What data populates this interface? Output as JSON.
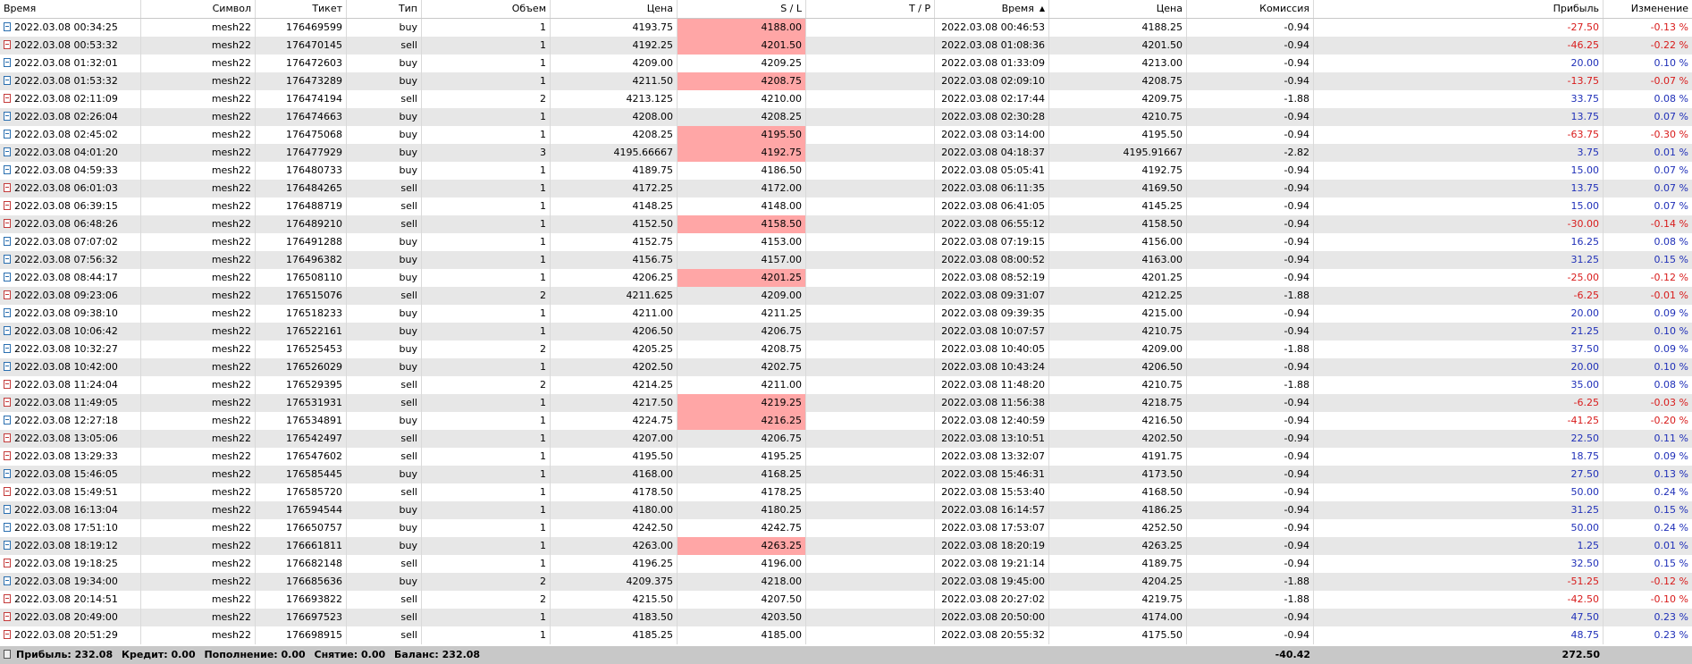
{
  "headers": {
    "time": "Время",
    "symbol": "Символ",
    "ticket": "Тикет",
    "type": "Тип",
    "volume": "Объем",
    "price": "Цена",
    "sl": "S / L",
    "tp": "T / P",
    "close_time": "Время",
    "close_price": "Цена",
    "commission": "Комиссия",
    "profit": "Прибыль",
    "change": "Изменение"
  },
  "colors": {
    "sl_hit_background": "#ffa6a6",
    "negative": "#d81b1b",
    "positive": "#1f2fb8",
    "alt_row": "#e7e7e7",
    "footer_background": "#c8c8c8"
  },
  "rows": [
    {
      "time": "2022.03.08 00:34:25",
      "symbol": "mesh22",
      "ticket": "176469599",
      "type": "buy",
      "volume": "1",
      "price": "4193.75",
      "sl": "4188.00",
      "sl_hit": true,
      "tp": "",
      "close_time": "2022.03.08 00:46:53",
      "close_price": "4188.25",
      "commission": "-0.94",
      "profit": "-27.50",
      "change": "-0.13 %",
      "negative": true
    },
    {
      "time": "2022.03.08 00:53:32",
      "symbol": "mesh22",
      "ticket": "176470145",
      "type": "sell",
      "volume": "1",
      "price": "4192.25",
      "sl": "4201.50",
      "sl_hit": true,
      "tp": "",
      "close_time": "2022.03.08 01:08:36",
      "close_price": "4201.50",
      "commission": "-0.94",
      "profit": "-46.25",
      "change": "-0.22 %",
      "negative": true
    },
    {
      "time": "2022.03.08 01:32:01",
      "symbol": "mesh22",
      "ticket": "176472603",
      "type": "buy",
      "volume": "1",
      "price": "4209.00",
      "sl": "4209.25",
      "sl_hit": false,
      "tp": "",
      "close_time": "2022.03.08 01:33:09",
      "close_price": "4213.00",
      "commission": "-0.94",
      "profit": "20.00",
      "change": "0.10 %",
      "negative": false
    },
    {
      "time": "2022.03.08 01:53:32",
      "symbol": "mesh22",
      "ticket": "176473289",
      "type": "buy",
      "volume": "1",
      "price": "4211.50",
      "sl": "4208.75",
      "sl_hit": true,
      "tp": "",
      "close_time": "2022.03.08 02:09:10",
      "close_price": "4208.75",
      "commission": "-0.94",
      "profit": "-13.75",
      "change": "-0.07 %",
      "negative": true
    },
    {
      "time": "2022.03.08 02:11:09",
      "symbol": "mesh22",
      "ticket": "176474194",
      "type": "sell",
      "volume": "2",
      "price": "4213.125",
      "sl": "4210.00",
      "sl_hit": false,
      "tp": "",
      "close_time": "2022.03.08 02:17:44",
      "close_price": "4209.75",
      "commission": "-1.88",
      "profit": "33.75",
      "change": "0.08 %",
      "negative": false
    },
    {
      "time": "2022.03.08 02:26:04",
      "symbol": "mesh22",
      "ticket": "176474663",
      "type": "buy",
      "volume": "1",
      "price": "4208.00",
      "sl": "4208.25",
      "sl_hit": false,
      "tp": "",
      "close_time": "2022.03.08 02:30:28",
      "close_price": "4210.75",
      "commission": "-0.94",
      "profit": "13.75",
      "change": "0.07 %",
      "negative": false
    },
    {
      "time": "2022.03.08 02:45:02",
      "symbol": "mesh22",
      "ticket": "176475068",
      "type": "buy",
      "volume": "1",
      "price": "4208.25",
      "sl": "4195.50",
      "sl_hit": true,
      "tp": "",
      "close_time": "2022.03.08 03:14:00",
      "close_price": "4195.50",
      "commission": "-0.94",
      "profit": "-63.75",
      "change": "-0.30 %",
      "negative": true
    },
    {
      "time": "2022.03.08 04:01:20",
      "symbol": "mesh22",
      "ticket": "176477929",
      "type": "buy",
      "volume": "3",
      "price": "4195.66667",
      "sl": "4192.75",
      "sl_hit": true,
      "tp": "",
      "close_time": "2022.03.08 04:18:37",
      "close_price": "4195.91667",
      "commission": "-2.82",
      "profit": "3.75",
      "change": "0.01 %",
      "negative": false
    },
    {
      "time": "2022.03.08 04:59:33",
      "symbol": "mesh22",
      "ticket": "176480733",
      "type": "buy",
      "volume": "1",
      "price": "4189.75",
      "sl": "4186.50",
      "sl_hit": false,
      "tp": "",
      "close_time": "2022.03.08 05:05:41",
      "close_price": "4192.75",
      "commission": "-0.94",
      "profit": "15.00",
      "change": "0.07 %",
      "negative": false
    },
    {
      "time": "2022.03.08 06:01:03",
      "symbol": "mesh22",
      "ticket": "176484265",
      "type": "sell",
      "volume": "1",
      "price": "4172.25",
      "sl": "4172.00",
      "sl_hit": false,
      "tp": "",
      "close_time": "2022.03.08 06:11:35",
      "close_price": "4169.50",
      "commission": "-0.94",
      "profit": "13.75",
      "change": "0.07 %",
      "negative": false
    },
    {
      "time": "2022.03.08 06:39:15",
      "symbol": "mesh22",
      "ticket": "176488719",
      "type": "sell",
      "volume": "1",
      "price": "4148.25",
      "sl": "4148.00",
      "sl_hit": false,
      "tp": "",
      "close_time": "2022.03.08 06:41:05",
      "close_price": "4145.25",
      "commission": "-0.94",
      "profit": "15.00",
      "change": "0.07 %",
      "negative": false
    },
    {
      "time": "2022.03.08 06:48:26",
      "symbol": "mesh22",
      "ticket": "176489210",
      "type": "sell",
      "volume": "1",
      "price": "4152.50",
      "sl": "4158.50",
      "sl_hit": true,
      "tp": "",
      "close_time": "2022.03.08 06:55:12",
      "close_price": "4158.50",
      "commission": "-0.94",
      "profit": "-30.00",
      "change": "-0.14 %",
      "negative": true
    },
    {
      "time": "2022.03.08 07:07:02",
      "symbol": "mesh22",
      "ticket": "176491288",
      "type": "buy",
      "volume": "1",
      "price": "4152.75",
      "sl": "4153.00",
      "sl_hit": false,
      "tp": "",
      "close_time": "2022.03.08 07:19:15",
      "close_price": "4156.00",
      "commission": "-0.94",
      "profit": "16.25",
      "change": "0.08 %",
      "negative": false
    },
    {
      "time": "2022.03.08 07:56:32",
      "symbol": "mesh22",
      "ticket": "176496382",
      "type": "buy",
      "volume": "1",
      "price": "4156.75",
      "sl": "4157.00",
      "sl_hit": false,
      "tp": "",
      "close_time": "2022.03.08 08:00:52",
      "close_price": "4163.00",
      "commission": "-0.94",
      "profit": "31.25",
      "change": "0.15 %",
      "negative": false
    },
    {
      "time": "2022.03.08 08:44:17",
      "symbol": "mesh22",
      "ticket": "176508110",
      "type": "buy",
      "volume": "1",
      "price": "4206.25",
      "sl": "4201.25",
      "sl_hit": true,
      "tp": "",
      "close_time": "2022.03.08 08:52:19",
      "close_price": "4201.25",
      "commission": "-0.94",
      "profit": "-25.00",
      "change": "-0.12 %",
      "negative": true
    },
    {
      "time": "2022.03.08 09:23:06",
      "symbol": "mesh22",
      "ticket": "176515076",
      "type": "sell",
      "volume": "2",
      "price": "4211.625",
      "sl": "4209.00",
      "sl_hit": false,
      "tp": "",
      "close_time": "2022.03.08 09:31:07",
      "close_price": "4212.25",
      "commission": "-1.88",
      "profit": "-6.25",
      "change": "-0.01 %",
      "negative": true
    },
    {
      "time": "2022.03.08 09:38:10",
      "symbol": "mesh22",
      "ticket": "176518233",
      "type": "buy",
      "volume": "1",
      "price": "4211.00",
      "sl": "4211.25",
      "sl_hit": false,
      "tp": "",
      "close_time": "2022.03.08 09:39:35",
      "close_price": "4215.00",
      "commission": "-0.94",
      "profit": "20.00",
      "change": "0.09 %",
      "negative": false
    },
    {
      "time": "2022.03.08 10:06:42",
      "symbol": "mesh22",
      "ticket": "176522161",
      "type": "buy",
      "volume": "1",
      "price": "4206.50",
      "sl": "4206.75",
      "sl_hit": false,
      "tp": "",
      "close_time": "2022.03.08 10:07:57",
      "close_price": "4210.75",
      "commission": "-0.94",
      "profit": "21.25",
      "change": "0.10 %",
      "negative": false
    },
    {
      "time": "2022.03.08 10:32:27",
      "symbol": "mesh22",
      "ticket": "176525453",
      "type": "buy",
      "volume": "2",
      "price": "4205.25",
      "sl": "4208.75",
      "sl_hit": false,
      "tp": "",
      "close_time": "2022.03.08 10:40:05",
      "close_price": "4209.00",
      "commission": "-1.88",
      "profit": "37.50",
      "change": "0.09 %",
      "negative": false
    },
    {
      "time": "2022.03.08 10:42:00",
      "symbol": "mesh22",
      "ticket": "176526029",
      "type": "buy",
      "volume": "1",
      "price": "4202.50",
      "sl": "4202.75",
      "sl_hit": false,
      "tp": "",
      "close_time": "2022.03.08 10:43:24",
      "close_price": "4206.50",
      "commission": "-0.94",
      "profit": "20.00",
      "change": "0.10 %",
      "negative": false
    },
    {
      "time": "2022.03.08 11:24:04",
      "symbol": "mesh22",
      "ticket": "176529395",
      "type": "sell",
      "volume": "2",
      "price": "4214.25",
      "sl": "4211.00",
      "sl_hit": false,
      "tp": "",
      "close_time": "2022.03.08 11:48:20",
      "close_price": "4210.75",
      "commission": "-1.88",
      "profit": "35.00",
      "change": "0.08 %",
      "negative": false
    },
    {
      "time": "2022.03.08 11:49:05",
      "symbol": "mesh22",
      "ticket": "176531931",
      "type": "sell",
      "volume": "1",
      "price": "4217.50",
      "sl": "4219.25",
      "sl_hit": true,
      "tp": "",
      "close_time": "2022.03.08 11:56:38",
      "close_price": "4218.75",
      "commission": "-0.94",
      "profit": "-6.25",
      "change": "-0.03 %",
      "negative": true
    },
    {
      "time": "2022.03.08 12:27:18",
      "symbol": "mesh22",
      "ticket": "176534891",
      "type": "buy",
      "volume": "1",
      "price": "4224.75",
      "sl": "4216.25",
      "sl_hit": true,
      "tp": "",
      "close_time": "2022.03.08 12:40:59",
      "close_price": "4216.50",
      "commission": "-0.94",
      "profit": "-41.25",
      "change": "-0.20 %",
      "negative": true
    },
    {
      "time": "2022.03.08 13:05:06",
      "symbol": "mesh22",
      "ticket": "176542497",
      "type": "sell",
      "volume": "1",
      "price": "4207.00",
      "sl": "4206.75",
      "sl_hit": false,
      "tp": "",
      "close_time": "2022.03.08 13:10:51",
      "close_price": "4202.50",
      "commission": "-0.94",
      "profit": "22.50",
      "change": "0.11 %",
      "negative": false
    },
    {
      "time": "2022.03.08 13:29:33",
      "symbol": "mesh22",
      "ticket": "176547602",
      "type": "sell",
      "volume": "1",
      "price": "4195.50",
      "sl": "4195.25",
      "sl_hit": false,
      "tp": "",
      "close_time": "2022.03.08 13:32:07",
      "close_price": "4191.75",
      "commission": "-0.94",
      "profit": "18.75",
      "change": "0.09 %",
      "negative": false
    },
    {
      "time": "2022.03.08 15:46:05",
      "symbol": "mesh22",
      "ticket": "176585445",
      "type": "buy",
      "volume": "1",
      "price": "4168.00",
      "sl": "4168.25",
      "sl_hit": false,
      "tp": "",
      "close_time": "2022.03.08 15:46:31",
      "close_price": "4173.50",
      "commission": "-0.94",
      "profit": "27.50",
      "change": "0.13 %",
      "negative": false
    },
    {
      "time": "2022.03.08 15:49:51",
      "symbol": "mesh22",
      "ticket": "176585720",
      "type": "sell",
      "volume": "1",
      "price": "4178.50",
      "sl": "4178.25",
      "sl_hit": false,
      "tp": "",
      "close_time": "2022.03.08 15:53:40",
      "close_price": "4168.50",
      "commission": "-0.94",
      "profit": "50.00",
      "change": "0.24 %",
      "negative": false
    },
    {
      "time": "2022.03.08 16:13:04",
      "symbol": "mesh22",
      "ticket": "176594544",
      "type": "buy",
      "volume": "1",
      "price": "4180.00",
      "sl": "4180.25",
      "sl_hit": false,
      "tp": "",
      "close_time": "2022.03.08 16:14:57",
      "close_price": "4186.25",
      "commission": "-0.94",
      "profit": "31.25",
      "change": "0.15 %",
      "negative": false
    },
    {
      "time": "2022.03.08 17:51:10",
      "symbol": "mesh22",
      "ticket": "176650757",
      "type": "buy",
      "volume": "1",
      "price": "4242.50",
      "sl": "4242.75",
      "sl_hit": false,
      "tp": "",
      "close_time": "2022.03.08 17:53:07",
      "close_price": "4252.50",
      "commission": "-0.94",
      "profit": "50.00",
      "change": "0.24 %",
      "negative": false
    },
    {
      "time": "2022.03.08 18:19:12",
      "symbol": "mesh22",
      "ticket": "176661811",
      "type": "buy",
      "volume": "1",
      "price": "4263.00",
      "sl": "4263.25",
      "sl_hit": true,
      "tp": "",
      "close_time": "2022.03.08 18:20:19",
      "close_price": "4263.25",
      "commission": "-0.94",
      "profit": "1.25",
      "change": "0.01 %",
      "negative": false
    },
    {
      "time": "2022.03.08 19:18:25",
      "symbol": "mesh22",
      "ticket": "176682148",
      "type": "sell",
      "volume": "1",
      "price": "4196.25",
      "sl": "4196.00",
      "sl_hit": false,
      "tp": "",
      "close_time": "2022.03.08 19:21:14",
      "close_price": "4189.75",
      "commission": "-0.94",
      "profit": "32.50",
      "change": "0.15 %",
      "negative": false
    },
    {
      "time": "2022.03.08 19:34:00",
      "symbol": "mesh22",
      "ticket": "176685636",
      "type": "buy",
      "volume": "2",
      "price": "4209.375",
      "sl": "4218.00",
      "sl_hit": false,
      "tp": "",
      "close_time": "2022.03.08 19:45:00",
      "close_price": "4204.25",
      "commission": "-1.88",
      "profit": "-51.25",
      "change": "-0.12 %",
      "negative": true
    },
    {
      "time": "2022.03.08 20:14:51",
      "symbol": "mesh22",
      "ticket": "176693822",
      "type": "sell",
      "volume": "2",
      "price": "4215.50",
      "sl": "4207.50",
      "sl_hit": false,
      "tp": "",
      "close_time": "2022.03.08 20:27:02",
      "close_price": "4219.75",
      "commission": "-1.88",
      "profit": "-42.50",
      "change": "-0.10 %",
      "negative": true
    },
    {
      "time": "2022.03.08 20:49:00",
      "symbol": "mesh22",
      "ticket": "176697523",
      "type": "sell",
      "volume": "1",
      "price": "4183.50",
      "sl": "4203.50",
      "sl_hit": false,
      "tp": "",
      "close_time": "2022.03.08 20:50:00",
      "close_price": "4174.00",
      "commission": "-0.94",
      "profit": "47.50",
      "change": "0.23 %",
      "negative": false
    },
    {
      "time": "2022.03.08 20:51:29",
      "symbol": "mesh22",
      "ticket": "176698915",
      "type": "sell",
      "volume": "1",
      "price": "4185.25",
      "sl": "4185.00",
      "sl_hit": false,
      "tp": "",
      "close_time": "2022.03.08 20:55:32",
      "close_price": "4175.50",
      "commission": "-0.94",
      "profit": "48.75",
      "change": "0.23 %",
      "negative": false
    }
  ],
  "footer": {
    "profit_label": "Прибыль: 232.08",
    "credit_label": "Кредит: 0.00",
    "deposit_label": "Пополнение: 0.00",
    "withdrawal_label": "Снятие: 0.00",
    "balance_label": "Баланс: 232.08",
    "commission_total": "-40.42",
    "profit_total": "272.50"
  }
}
